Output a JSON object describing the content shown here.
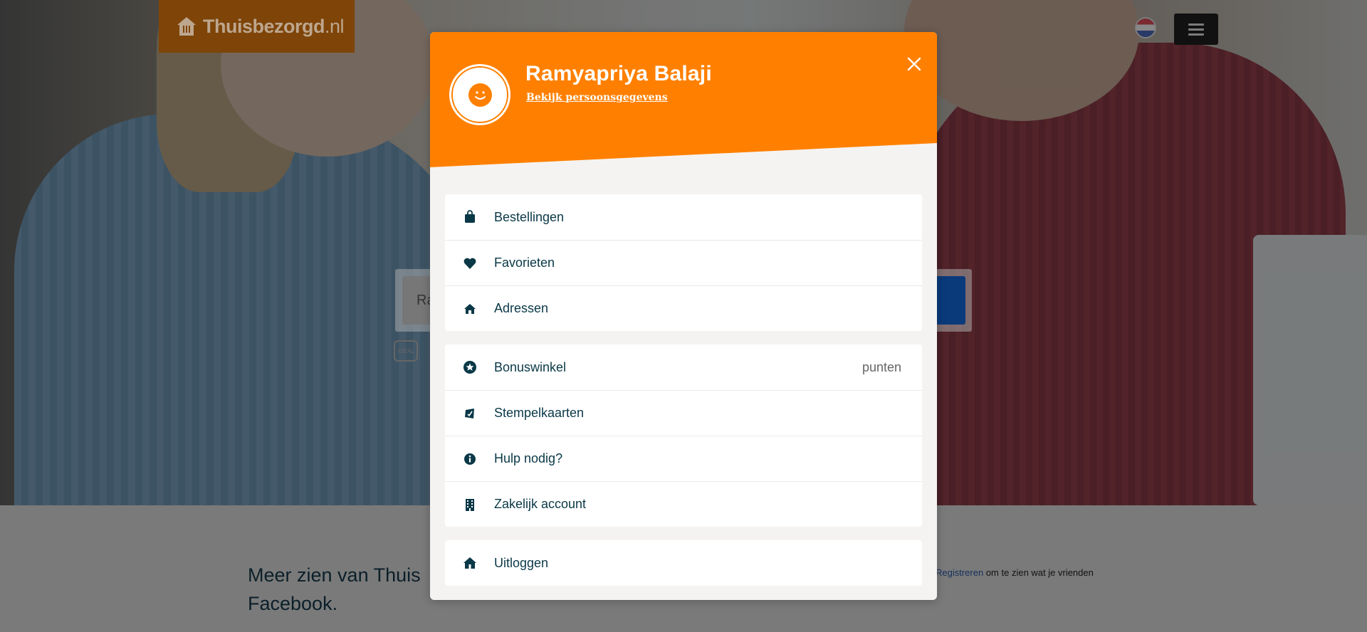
{
  "header": {
    "logo_text_main": "Thuisbezorgd",
    "logo_text_suffix": ".nl"
  },
  "search": {
    "value": "Ra"
  },
  "payment_badge": "iDEAL",
  "facebook_section": {
    "text": "Meer zien van Thuis Facebook.",
    "register_link": "Registreren",
    "register_rest": "om te zien wat je vrienden"
  },
  "modal": {
    "user_name": "Ramyapriya Balaji",
    "profile_link": "Bekijk persoonsgegevens",
    "colors": {
      "accent": "#ff8000",
      "text": "#0a3847",
      "panel": "#f5f3f1"
    },
    "groups": [
      {
        "items": [
          {
            "label": "Bestellingen",
            "icon": "shopping-bag-icon"
          },
          {
            "label": "Favorieten",
            "icon": "heart-icon"
          },
          {
            "label": "Adressen",
            "icon": "home-icon"
          }
        ]
      },
      {
        "items": [
          {
            "label": "Bonuswinkel",
            "icon": "star-icon",
            "trail": "punten"
          },
          {
            "label": "Stempelkaarten",
            "icon": "stamp-card-icon"
          },
          {
            "label": "Hulp nodig?",
            "icon": "info-icon"
          },
          {
            "label": "Zakelijk account",
            "icon": "building-icon"
          }
        ]
      },
      {
        "items": [
          {
            "label": "Uitloggen",
            "icon": "logout-house-icon"
          }
        ]
      }
    ]
  }
}
